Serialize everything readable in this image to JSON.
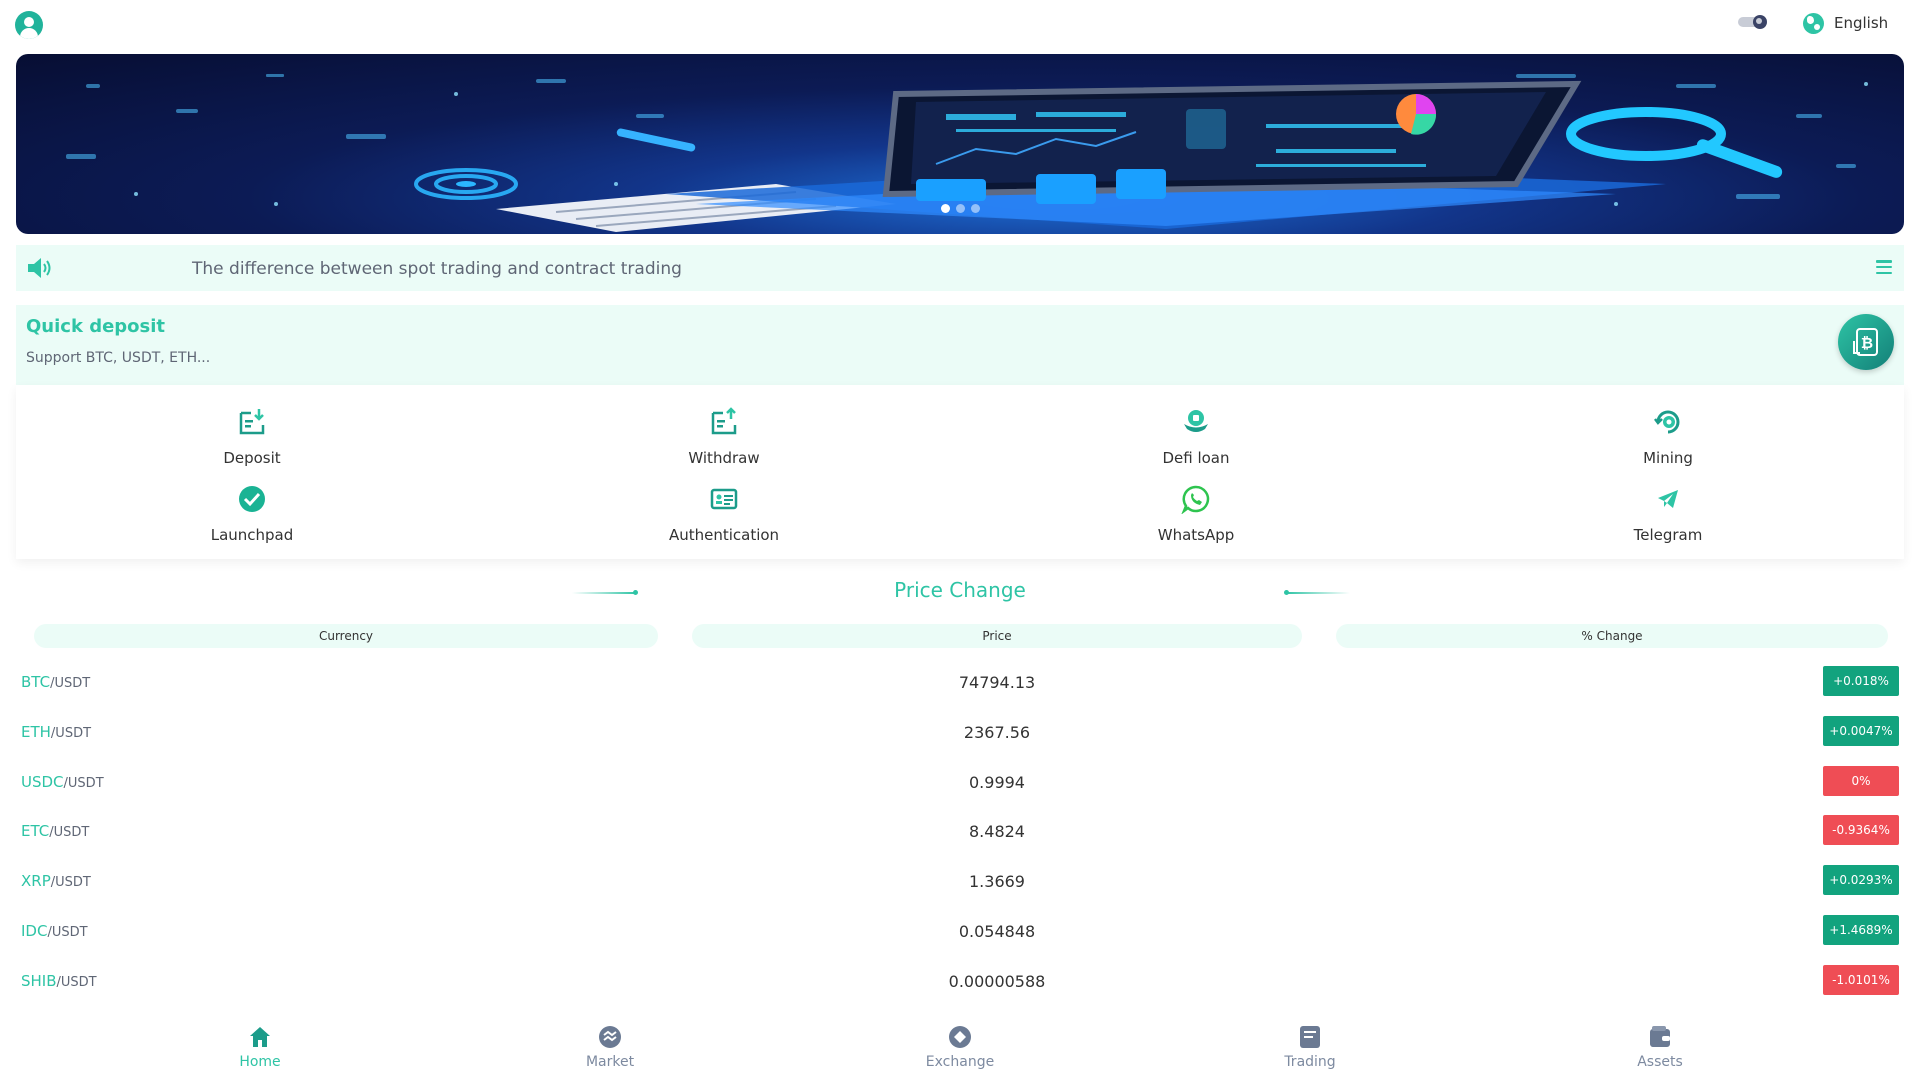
{
  "header": {
    "avatar_icon": "user-avatar-icon",
    "theme_toggle_icon": "dark-mode-toggle-icon",
    "language_icon": "globe-icon",
    "language_label": "English"
  },
  "banner": {
    "slides": 3,
    "active_slide": 1
  },
  "notice": {
    "icon": "speaker-icon",
    "text": "The difference between spot trading and contract trading",
    "menu_icon": "hamburger-menu-icon"
  },
  "quick_deposit": {
    "title": "Quick deposit",
    "subtitle": "Support BTC, USDT, ETH...",
    "icon": "bitcoin-deposit-icon"
  },
  "actions": [
    {
      "label": "Deposit",
      "icon": "deposit-icon"
    },
    {
      "label": "Withdraw",
      "icon": "withdraw-icon"
    },
    {
      "label": "Defi loan",
      "icon": "defi-loan-icon"
    },
    {
      "label": "Mining",
      "icon": "mining-icon"
    },
    {
      "label": "Launchpad",
      "icon": "checkmark-icon"
    },
    {
      "label": "Authentication",
      "icon": "id-card-icon"
    },
    {
      "label": "WhatsApp",
      "icon": "whatsapp-icon"
    },
    {
      "label": "Telegram",
      "icon": "telegram-icon"
    }
  ],
  "price_change": {
    "title": "Price Change",
    "headers": [
      "Currency",
      "Price",
      "% Change"
    ],
    "rows": [
      {
        "base": "BTC",
        "quote": "/USDT",
        "price": "74794.13",
        "change": "+0.018%",
        "direction": "up"
      },
      {
        "base": "ETH",
        "quote": "/USDT",
        "price": "2367.56",
        "change": "+0.0047%",
        "direction": "up"
      },
      {
        "base": "USDC",
        "quote": "/USDT",
        "price": "0.9994",
        "change": "0%",
        "direction": "down"
      },
      {
        "base": "ETC",
        "quote": "/USDT",
        "price": "8.4824",
        "change": "-0.9364%",
        "direction": "down"
      },
      {
        "base": "XRP",
        "quote": "/USDT",
        "price": "1.3669",
        "change": "+0.0293%",
        "direction": "up"
      },
      {
        "base": "IDC",
        "quote": "/USDT",
        "price": "0.054848",
        "change": "+1.4689%",
        "direction": "up"
      },
      {
        "base": "SHIB",
        "quote": "/USDT",
        "price": "0.00000588",
        "change": "-1.0101%",
        "direction": "down"
      }
    ]
  },
  "tabbar": [
    {
      "label": "Home",
      "icon": "home-icon",
      "active": true
    },
    {
      "label": "Market",
      "icon": "market-icon",
      "active": false
    },
    {
      "label": "Exchange",
      "icon": "exchange-icon",
      "active": false
    },
    {
      "label": "Trading",
      "icon": "trading-icon",
      "active": false
    },
    {
      "label": "Assets",
      "icon": "wallet-icon",
      "active": false
    }
  ],
  "colors": {
    "accent": "#2ec4a5",
    "up": "#12a37e",
    "down": "#ef4d55",
    "panel_bg": "#ebfcf7"
  }
}
